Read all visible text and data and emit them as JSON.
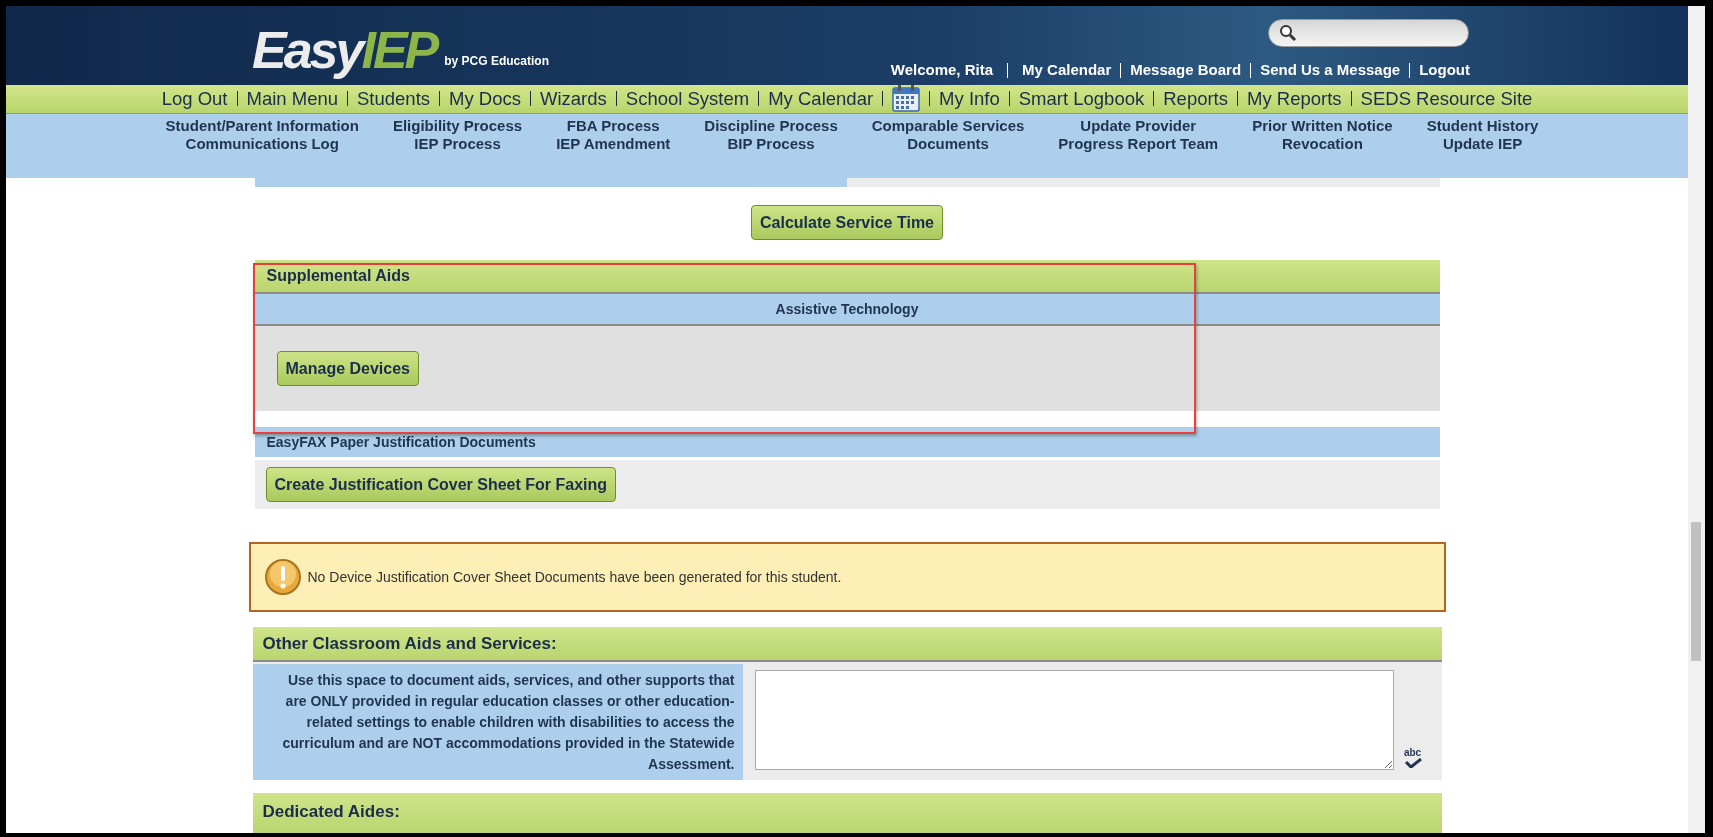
{
  "logo": {
    "brand": "Easy",
    "brand_accent": "IEP",
    "byline": "by PCG Education"
  },
  "welcome": "Welcome, Rita",
  "user_links": [
    "My Calendar",
    "Message Board",
    "Send Us a Message",
    "Logout"
  ],
  "main_nav": [
    {
      "label": "Log Out",
      "kind": "link"
    },
    {
      "label": "Main Menu",
      "kind": "link"
    },
    {
      "label": "Students",
      "kind": "link"
    },
    {
      "label": "My Docs",
      "kind": "link"
    },
    {
      "label": "Wizards",
      "kind": "link"
    },
    {
      "label": "School System",
      "kind": "link"
    },
    {
      "label": "My Calendar",
      "kind": "link"
    },
    {
      "kind": "calendar_icon"
    },
    {
      "label": "My Info",
      "kind": "link"
    },
    {
      "label": "Smart Logbook",
      "kind": "link"
    },
    {
      "label": "Reports",
      "kind": "link"
    },
    {
      "label": "My Reports",
      "kind": "link"
    },
    {
      "label": "SEDS Resource Site",
      "kind": "link"
    }
  ],
  "sub_nav": [
    {
      "lines": [
        "Student/Parent Information",
        "Communications Log"
      ]
    },
    {
      "lines": [
        "Eligibility Process",
        "IEP Process"
      ]
    },
    {
      "lines": [
        "FBA Process",
        "IEP Amendment"
      ]
    },
    {
      "lines": [
        "Discipline Process",
        "BIP Process"
      ]
    },
    {
      "lines": [
        "Comparable Services",
        "Documents"
      ]
    },
    {
      "lines": [
        "Update Provider",
        "Progress Report Team"
      ]
    },
    {
      "lines": [
        "Prior Written Notice",
        "Revocation"
      ]
    },
    {
      "lines": [
        "Student History",
        "Update IEP"
      ]
    }
  ],
  "calculate_button": "Calculate Service Time",
  "supplemental_aids": {
    "title": "Supplemental Aids",
    "subheader": "Assistive Technology",
    "button": "Manage Devices"
  },
  "easyfax": {
    "title": "EasyFAX Paper Justification Documents",
    "button": "Create Justification Cover Sheet For Faxing"
  },
  "warning": {
    "message": "No Device Justification Cover Sheet Documents have been generated for this student."
  },
  "other_aids": {
    "title": "Other Classroom Aids and Services:",
    "instructions": "Use this space to document aids, services, and other supports that are ONLY provided in regular education classes or other education-related settings to enable children with disabilities to access the curriculum and are NOT accommodations provided in the Statewide Assessment.",
    "spellcheck_label": "abc"
  },
  "dedicated_aides": {
    "title": "Dedicated Aides:"
  }
}
